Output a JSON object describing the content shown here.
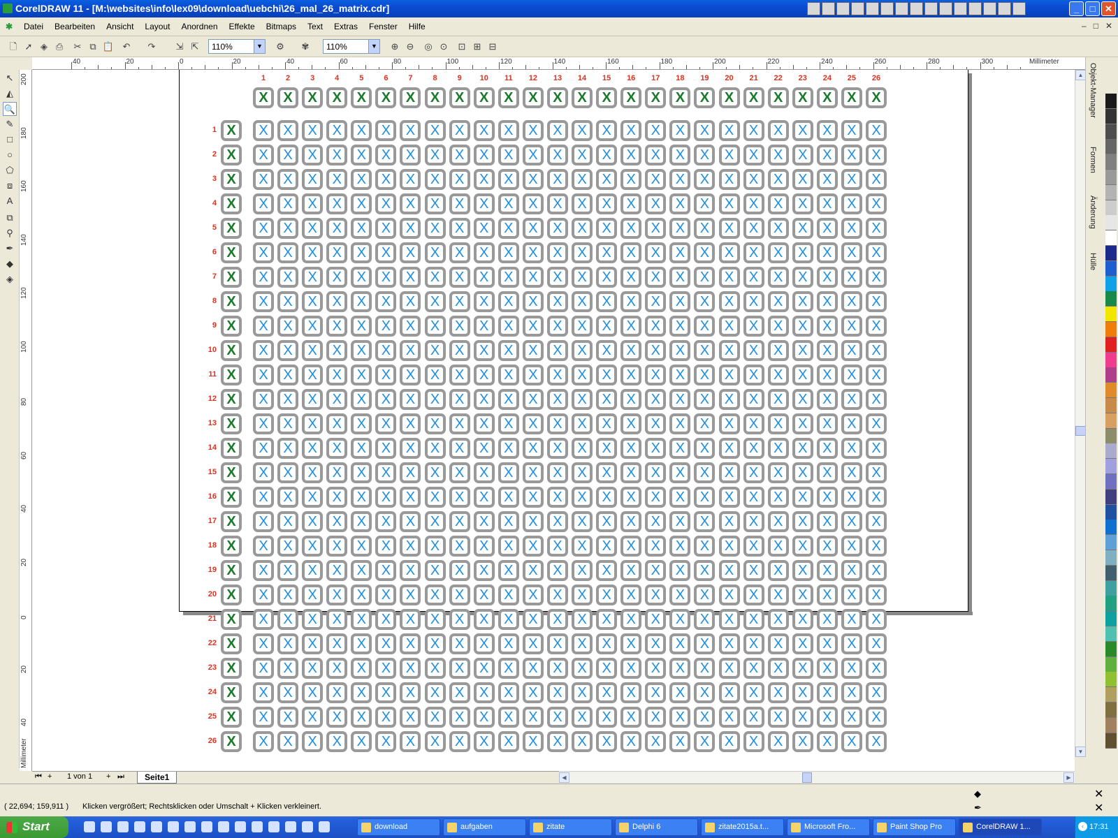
{
  "window": {
    "title": "CorelDRAW 11 - [M:\\websites\\info\\lex09\\download\\uebchi\\26_mal_26_matrix.cdr]",
    "buttons": [
      "_",
      "□",
      "✕"
    ]
  },
  "menu": {
    "items": [
      "Datei",
      "Bearbeiten",
      "Ansicht",
      "Layout",
      "Anordnen",
      "Effekte",
      "Bitmaps",
      "Text",
      "Extras",
      "Fenster",
      "Hilfe"
    ],
    "doc_buttons": [
      "–",
      "□",
      "✕"
    ]
  },
  "toolbar": {
    "zoom_left": "110%",
    "zoom_right": "110%"
  },
  "ruler": {
    "unit": "Millimeter",
    "h_labels": [
      "40",
      "20",
      "0",
      "20",
      "40",
      "60",
      "80",
      "100",
      "120",
      "140",
      "160",
      "180",
      "200",
      "220",
      "240",
      "260",
      "280",
      "300"
    ],
    "v_labels": [
      "200",
      "180",
      "160",
      "140",
      "120",
      "100",
      "80",
      "60",
      "40",
      "20",
      "0",
      "20",
      "40"
    ]
  },
  "matrix": {
    "columns": [
      "1",
      "2",
      "3",
      "4",
      "5",
      "6",
      "7",
      "8",
      "9",
      "10",
      "11",
      "12",
      "13",
      "14",
      "15",
      "16",
      "17",
      "18",
      "19",
      "20",
      "21",
      "22",
      "23",
      "24",
      "25",
      "26"
    ],
    "rows": [
      "1",
      "2",
      "3",
      "4",
      "5",
      "6",
      "7",
      "8",
      "9",
      "10",
      "11",
      "12",
      "13",
      "14",
      "15",
      "16",
      "17",
      "18",
      "19",
      "20",
      "21",
      "22",
      "23",
      "24",
      "25",
      "26"
    ],
    "cell_glyph": "X",
    "header_color": "#1a7a2c",
    "body_color": "#1e8ee0",
    "number_color": "#e0301e",
    "frame_color": "#999999"
  },
  "dockers": {
    "tabs": [
      "Objekt-Manager",
      "Formen",
      "Änderung",
      "Hülle"
    ]
  },
  "palette": {
    "colors": [
      "#1a1a1a",
      "#333",
      "#4d4d4d",
      "#666",
      "#808080",
      "#999",
      "#b3b3b3",
      "#ccc",
      "#e6e6e6",
      "#fff",
      "#1b2a8a",
      "#1e5fd0",
      "#10a0e8",
      "#1a8a4a",
      "#f2e600",
      "#f07d0a",
      "#e02020",
      "#f03c8c",
      "#b03c8c",
      "#e08a2a",
      "#c88a4a",
      "#d8a060",
      "#8c8c6a",
      "#aac",
      "#a0a0e0",
      "#7070c0",
      "#404080",
      "#2050a0",
      "#1070d0",
      "#60a0d8",
      "#80b0c0",
      "#406070",
      "#40a0a0",
      "#20a080",
      "#10a0a0",
      "#50c0b0",
      "#2a8a2a",
      "#60b040",
      "#90c030",
      "#b0a060",
      "#807040",
      "#a08060",
      "#605030"
    ]
  },
  "pages": {
    "counter": "1 von 1",
    "current": "Seite1"
  },
  "status": {
    "coords": "( 22,694; 159,911 )",
    "hint": "Klicken vergrößert; Rechtsklicken oder Umschalt + Klicken verkleinert."
  },
  "taskbar": {
    "start": "Start",
    "tasks": [
      "download",
      "aufgaben",
      "zitate",
      "Delphi 6",
      "zitate2015a.t...",
      "Microsoft Fro...",
      "Paint Shop Pro",
      "CorelDRAW 1..."
    ],
    "clock": "17:31"
  }
}
